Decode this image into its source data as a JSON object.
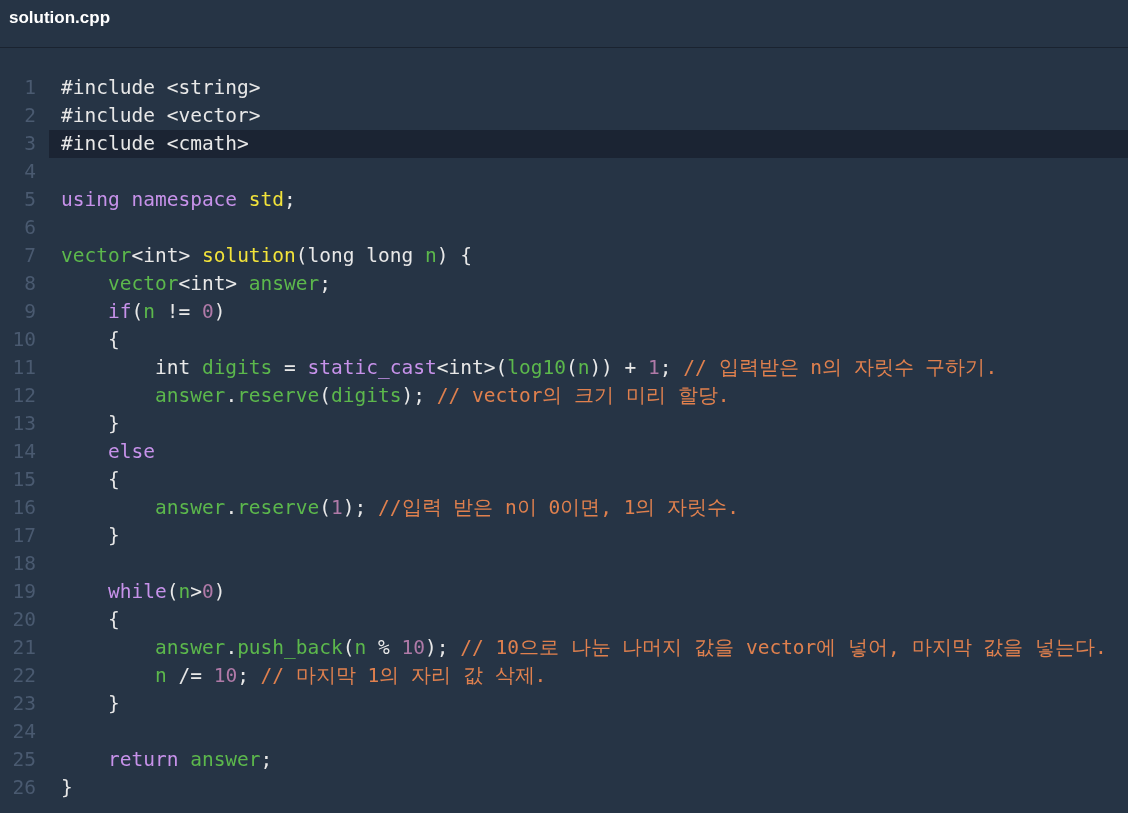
{
  "tab": {
    "title": "solution.cpp"
  },
  "lines": [
    {
      "number": "1",
      "highlighted": false,
      "tokens": [
        {
          "text": "#include <string>",
          "kind": "plain"
        }
      ]
    },
    {
      "number": "2",
      "highlighted": false,
      "tokens": [
        {
          "text": "#include <vector>",
          "kind": "plain"
        }
      ]
    },
    {
      "number": "3",
      "highlighted": true,
      "tokens": [
        {
          "text": "#include <cmath>",
          "kind": "plain"
        }
      ]
    },
    {
      "number": "4",
      "highlighted": false
    },
    {
      "number": "5",
      "highlighted": false,
      "tokens": [
        {
          "text": "using",
          "kind": "keyword"
        },
        {
          "text": " namespace",
          "kind": "keyword"
        },
        {
          "text": " std",
          "kind": "function"
        },
        {
          "text": ";",
          "kind": "plain"
        }
      ]
    },
    {
      "number": "6",
      "highlighted": false
    },
    {
      "number": "7",
      "highlighted": false,
      "tokens": [
        {
          "text": "vector",
          "kind": "identifier"
        },
        {
          "text": "<int> ",
          "kind": "plain"
        },
        {
          "text": "solution",
          "kind": "function"
        },
        {
          "text": "(long long ",
          "kind": "plain"
        },
        {
          "text": "n",
          "kind": "identifier"
        },
        {
          "text": ") {",
          "kind": "plain"
        }
      ]
    },
    {
      "number": "8",
      "highlighted": false,
      "tokens": [
        {
          "text": "    vector",
          "kind": "identifier"
        },
        {
          "text": "<int> ",
          "kind": "plain"
        },
        {
          "text": "answer",
          "kind": "identifier"
        },
        {
          "text": ";",
          "kind": "plain"
        }
      ]
    },
    {
      "number": "9",
      "highlighted": false,
      "tokens": [
        {
          "text": "    if",
          "kind": "keyword"
        },
        {
          "text": "(",
          "kind": "plain"
        },
        {
          "text": "n",
          "kind": "identifier"
        },
        {
          "text": " != ",
          "kind": "plain"
        },
        {
          "text": "0",
          "kind": "number"
        },
        {
          "text": ")",
          "kind": "plain"
        }
      ]
    },
    {
      "number": "10",
      "highlighted": false,
      "tokens": [
        {
          "text": "    {",
          "kind": "plain"
        }
      ]
    },
    {
      "number": "11",
      "highlighted": false,
      "tokens": [
        {
          "text": "        int ",
          "kind": "plain"
        },
        {
          "text": "digits",
          "kind": "identifier"
        },
        {
          "text": " = ",
          "kind": "plain"
        },
        {
          "text": "static_cast",
          "kind": "keyword"
        },
        {
          "text": "<int>(",
          "kind": "plain"
        },
        {
          "text": "log10",
          "kind": "identifier"
        },
        {
          "text": "(",
          "kind": "plain"
        },
        {
          "text": "n",
          "kind": "identifier"
        },
        {
          "text": ")) + ",
          "kind": "plain"
        },
        {
          "text": "1",
          "kind": "number"
        },
        {
          "text": "; ",
          "kind": "plain"
        },
        {
          "text": "// 입력받은 n의 자릿수 구하기.",
          "kind": "comment"
        }
      ]
    },
    {
      "number": "12",
      "highlighted": false,
      "tokens": [
        {
          "text": "        answer",
          "kind": "identifier"
        },
        {
          "text": ".",
          "kind": "plain"
        },
        {
          "text": "reserve",
          "kind": "identifier"
        },
        {
          "text": "(",
          "kind": "plain"
        },
        {
          "text": "digits",
          "kind": "identifier"
        },
        {
          "text": "); ",
          "kind": "plain"
        },
        {
          "text": "// vector의 크기 미리 할당.",
          "kind": "comment"
        }
      ]
    },
    {
      "number": "13",
      "highlighted": false,
      "tokens": [
        {
          "text": "    }",
          "kind": "plain"
        }
      ]
    },
    {
      "number": "14",
      "highlighted": false,
      "tokens": [
        {
          "text": "    else",
          "kind": "keyword"
        }
      ]
    },
    {
      "number": "15",
      "highlighted": false,
      "tokens": [
        {
          "text": "    {",
          "kind": "plain"
        }
      ]
    },
    {
      "number": "16",
      "highlighted": false,
      "tokens": [
        {
          "text": "        answer",
          "kind": "identifier"
        },
        {
          "text": ".",
          "kind": "plain"
        },
        {
          "text": "reserve",
          "kind": "identifier"
        },
        {
          "text": "(",
          "kind": "plain"
        },
        {
          "text": "1",
          "kind": "number"
        },
        {
          "text": "); ",
          "kind": "plain"
        },
        {
          "text": "//입력 받은 n이 0이면, 1의 자릿수.",
          "kind": "comment"
        }
      ]
    },
    {
      "number": "17",
      "highlighted": false,
      "tokens": [
        {
          "text": "    }",
          "kind": "plain"
        }
      ]
    },
    {
      "number": "18",
      "highlighted": false
    },
    {
      "number": "19",
      "highlighted": false,
      "tokens": [
        {
          "text": "    while",
          "kind": "keyword"
        },
        {
          "text": "(",
          "kind": "plain"
        },
        {
          "text": "n",
          "kind": "identifier"
        },
        {
          "text": ">",
          "kind": "plain"
        },
        {
          "text": "0",
          "kind": "number"
        },
        {
          "text": ")",
          "kind": "plain"
        }
      ]
    },
    {
      "number": "20",
      "highlighted": false,
      "tokens": [
        {
          "text": "    {",
          "kind": "plain"
        }
      ]
    },
    {
      "number": "21",
      "highlighted": false,
      "tokens": [
        {
          "text": "        answer",
          "kind": "identifier"
        },
        {
          "text": ".",
          "kind": "plain"
        },
        {
          "text": "push_back",
          "kind": "identifier"
        },
        {
          "text": "(",
          "kind": "plain"
        },
        {
          "text": "n",
          "kind": "identifier"
        },
        {
          "text": " % ",
          "kind": "plain"
        },
        {
          "text": "10",
          "kind": "number"
        },
        {
          "text": "); ",
          "kind": "plain"
        },
        {
          "text": "// 10으로 나눈 나머지 값을 vector에 넣어, 마지막 값을 넣는다.",
          "kind": "comment"
        }
      ]
    },
    {
      "number": "22",
      "highlighted": false,
      "tokens": [
        {
          "text": "        n",
          "kind": "identifier"
        },
        {
          "text": " /= ",
          "kind": "plain"
        },
        {
          "text": "10",
          "kind": "number"
        },
        {
          "text": "; ",
          "kind": "plain"
        },
        {
          "text": "// 마지막 1의 자리 값 삭제.",
          "kind": "comment"
        }
      ]
    },
    {
      "number": "23",
      "highlighted": false,
      "tokens": [
        {
          "text": "    }",
          "kind": "plain"
        }
      ]
    },
    {
      "number": "24",
      "highlighted": false
    },
    {
      "number": "25",
      "highlighted": false,
      "tokens": [
        {
          "text": "    return",
          "kind": "keyword"
        },
        {
          "text": " answer",
          "kind": "identifier"
        },
        {
          "text": ";",
          "kind": "plain"
        }
      ]
    },
    {
      "number": "26",
      "highlighted": false,
      "tokens": [
        {
          "text": "}",
          "kind": "plain"
        }
      ]
    }
  ]
}
